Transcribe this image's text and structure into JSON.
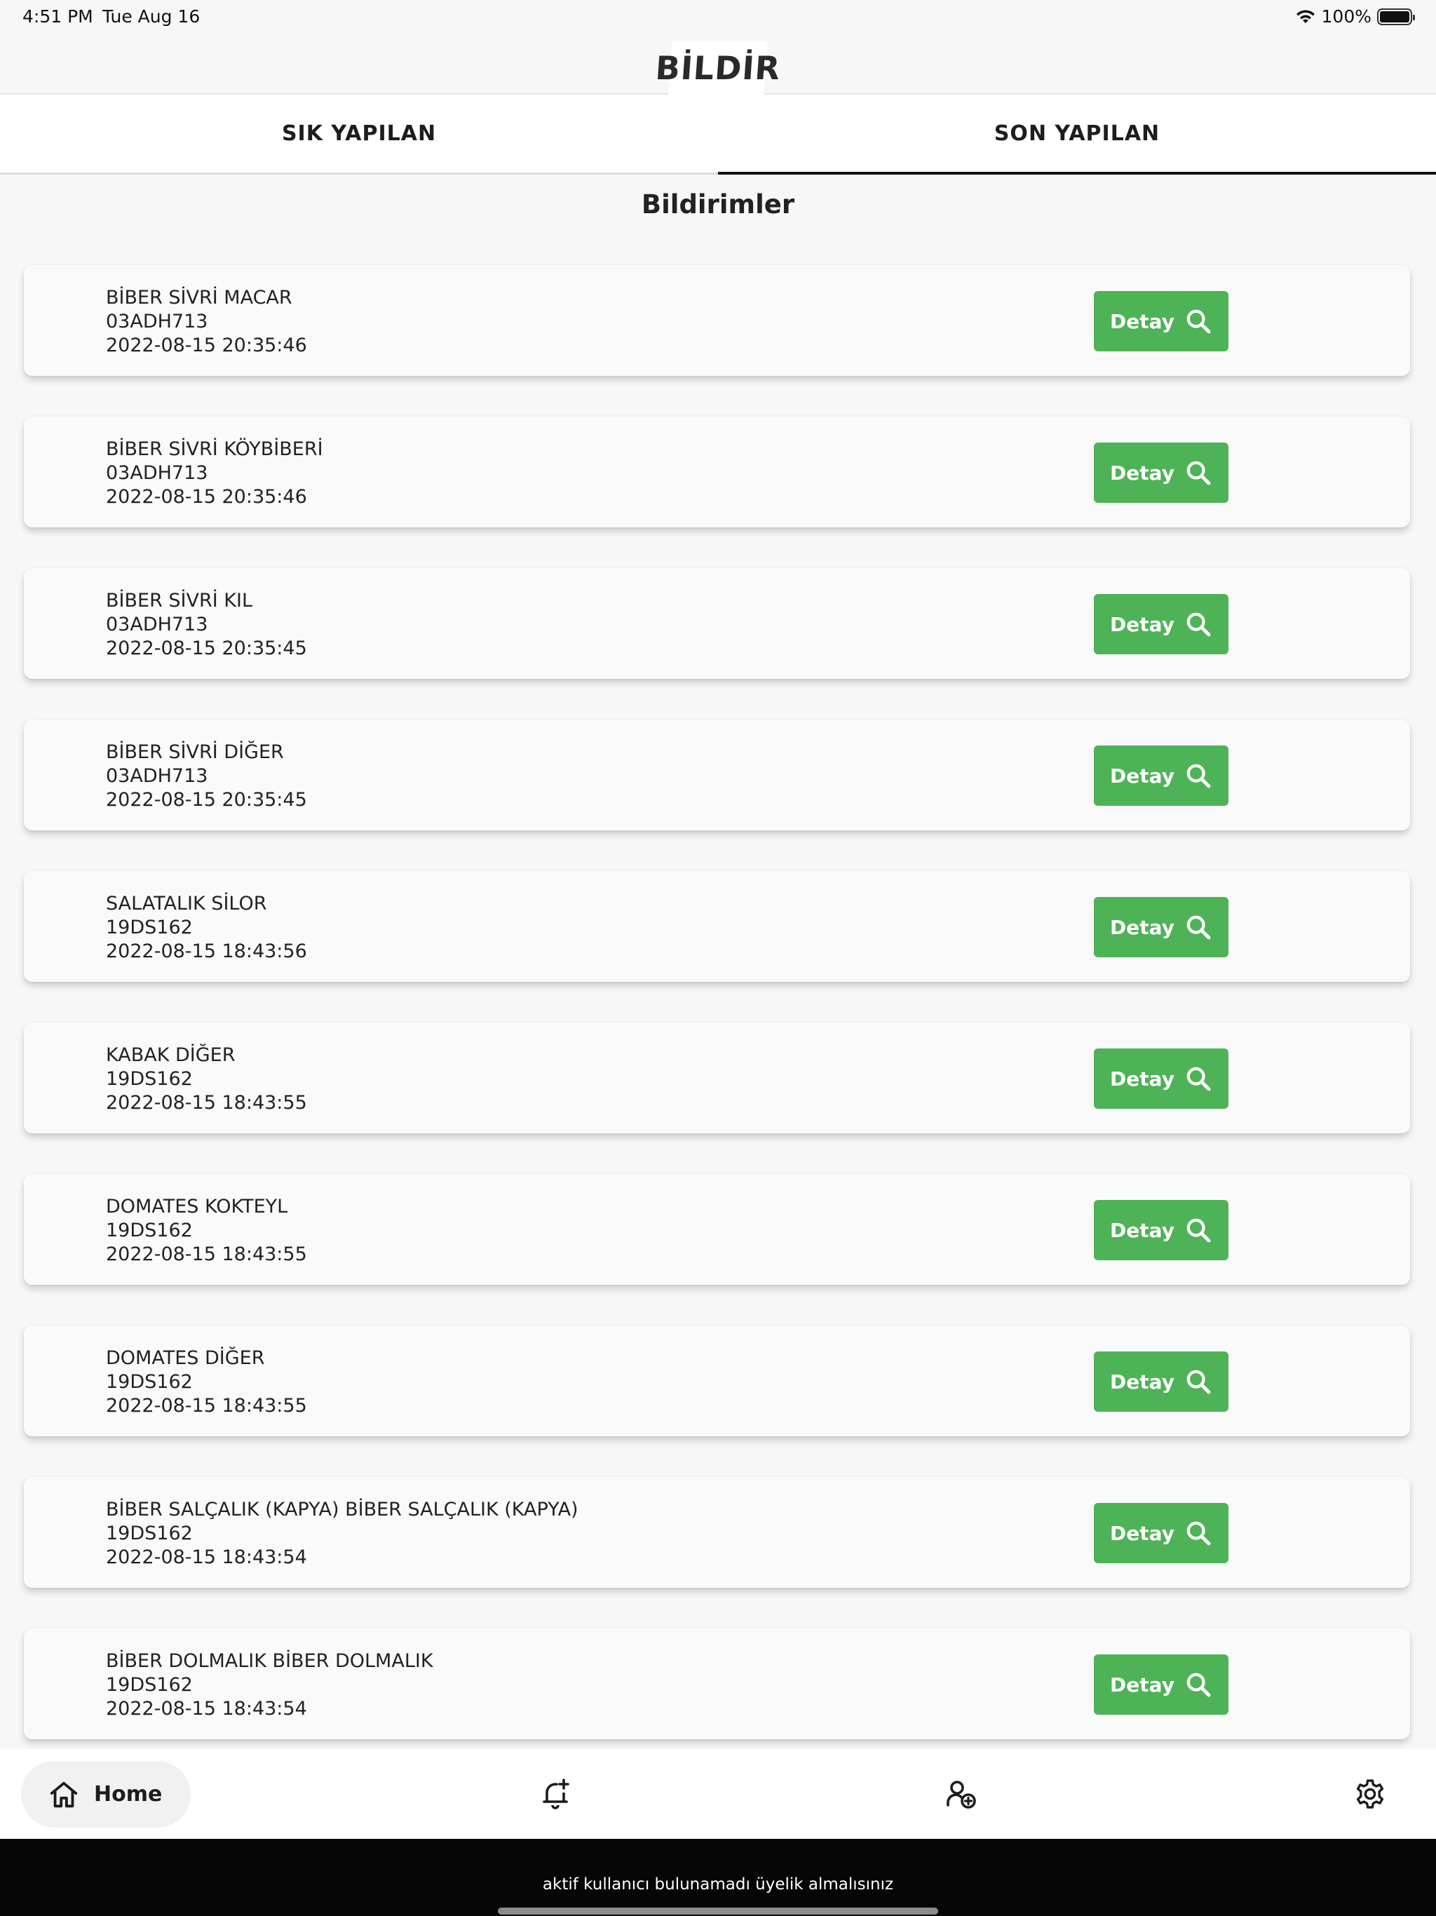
{
  "status_bar": {
    "time": "4:51 PM",
    "date": "Tue Aug 16",
    "battery": "100%"
  },
  "header": {
    "logo_text": "BİLDİR"
  },
  "tabs": [
    {
      "label": "SIK YAPILAN",
      "active": false
    },
    {
      "label": "SON YAPILAN",
      "active": true
    }
  ],
  "page_title": "Bildirimler",
  "detay_label": "Detay",
  "items": [
    {
      "name": "BİBER SİVRİ MACAR",
      "code": "03ADH713",
      "date": "2022-08-15 20:35:46"
    },
    {
      "name": "BİBER SİVRİ KÖYBİBERİ",
      "code": "03ADH713",
      "date": "2022-08-15 20:35:46"
    },
    {
      "name": "BİBER SİVRİ KIL",
      "code": "03ADH713",
      "date": "2022-08-15 20:35:45"
    },
    {
      "name": "BİBER SİVRİ DİĞER",
      "code": "03ADH713",
      "date": "2022-08-15 20:35:45"
    },
    {
      "name": "SALATALIK SİLOR",
      "code": "19DS162",
      "date": "2022-08-15 18:43:56"
    },
    {
      "name": "KABAK DİĞER",
      "code": "19DS162",
      "date": "2022-08-15 18:43:55"
    },
    {
      "name": "DOMATES KOKTEYL",
      "code": "19DS162",
      "date": "2022-08-15 18:43:55"
    },
    {
      "name": "DOMATES DİĞER",
      "code": "19DS162",
      "date": "2022-08-15 18:43:55"
    },
    {
      "name": "BİBER SALÇALIK (KAPYA) BİBER SALÇALIK (KAPYA)",
      "code": "19DS162",
      "date": "2022-08-15 18:43:54"
    },
    {
      "name": "BİBER DOLMALIK BİBER DOLMALIK",
      "code": "19DS162",
      "date": "2022-08-15 18:43:54"
    }
  ],
  "bottom_nav": {
    "home_label": "Home",
    "icons": [
      "home-icon",
      "notification-add-icon",
      "person-add-icon",
      "settings-icon"
    ]
  },
  "snackbar": {
    "message": "aktif kullanıcı bulunamadı üyelik almalısınız"
  },
  "colors": {
    "accent": "#4db356",
    "snackbar_bg": "#060606"
  }
}
